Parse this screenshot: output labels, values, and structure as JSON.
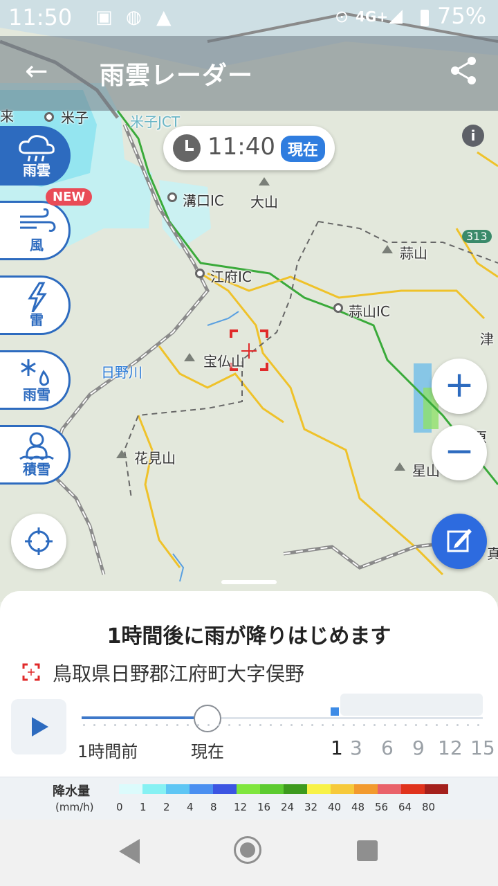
{
  "status_bar": {
    "time": "11:50",
    "network": "4G+",
    "battery": "75%"
  },
  "app_bar": {
    "title": "雨雲レーダー",
    "back_icon": "arrow-back-icon",
    "share_icon": "share-icon"
  },
  "time_pill": {
    "time": "11:40",
    "now_label": "現在"
  },
  "side_menu": {
    "items": [
      {
        "label": "雨雲",
        "icon": "rain-cloud-icon",
        "active": true
      },
      {
        "label": "風",
        "icon": "wind-icon",
        "active": false
      },
      {
        "label": "雷",
        "icon": "lightning-icon",
        "active": false
      },
      {
        "label": "雨雪",
        "icon": "sleet-icon",
        "active": false
      },
      {
        "label": "積雪",
        "icon": "snowman-icon",
        "active": false
      }
    ],
    "new_badge": "NEW"
  },
  "map": {
    "labels": {
      "yonago": "米子",
      "yonago_left": "来",
      "yonago_jct": "米子JCT",
      "mizoguchi_ic": "溝口IC",
      "daisen": "大山",
      "kofu_ic": "江府IC",
      "hiruzen_ic": "蒜山IC",
      "hiruzen": "蒜山",
      "route": "313",
      "takarabutsu": "宝仏山",
      "hino_river": "日野川",
      "hanami": "花見山",
      "hoshi": "星山",
      "hara": "原",
      "tsu": "津",
      "ma": "真"
    }
  },
  "controls": {
    "zoom_in": "+",
    "zoom_out": "−"
  },
  "sheet": {
    "message": "1時間後に雨が降りはじめます",
    "address": "鳥取県日野郡江府町大字俣野",
    "timeline": {
      "past_label": "1時間前",
      "now_label": "現在",
      "hours": [
        "1",
        "3",
        "6",
        "9",
        "12",
        "15"
      ],
      "selected_hour": "1"
    }
  },
  "legend": {
    "title": "降水量",
    "unit": "(mm/h)",
    "values": [
      "0",
      "1",
      "2",
      "4",
      "8",
      "12",
      "16",
      "24",
      "32",
      "40",
      "48",
      "56",
      "64",
      "80"
    ],
    "colors": [
      "#dcfbfc",
      "#86f1f3",
      "#5ec6f4",
      "#4a8ff0",
      "#3c55e2",
      "#7fe63e",
      "#5ccb30",
      "#3d9a1e",
      "#f8f247",
      "#f6c93a",
      "#f29a2e",
      "#e9626a",
      "#e0331d",
      "#a4201c"
    ]
  }
}
